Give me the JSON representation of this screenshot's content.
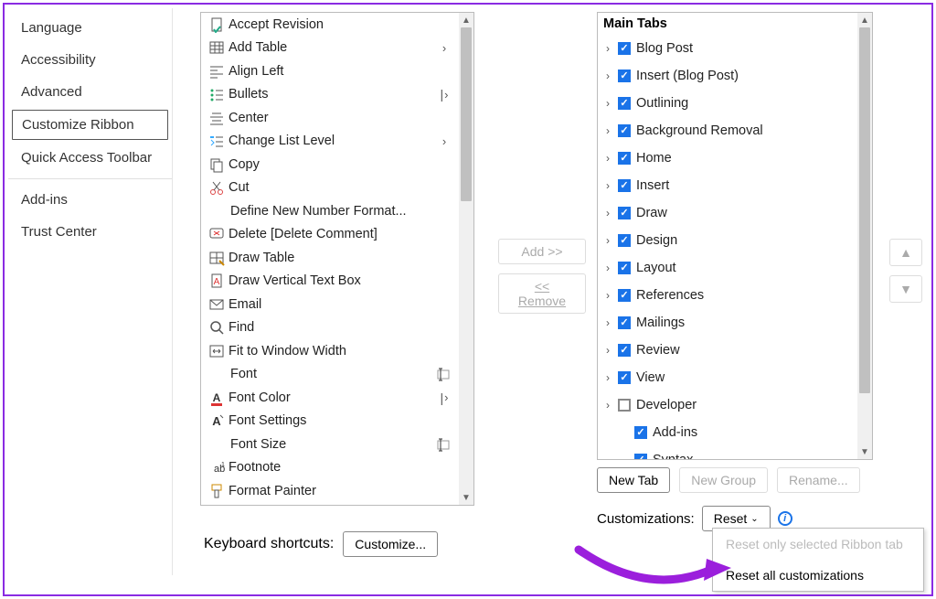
{
  "sidebar": {
    "items": [
      {
        "label": "Language",
        "sel": false
      },
      {
        "label": "Accessibility",
        "sel": false
      },
      {
        "label": "Advanced",
        "sel": false
      },
      {
        "label": "Customize Ribbon",
        "sel": true
      },
      {
        "label": "Quick Access Toolbar",
        "sel": false
      },
      {
        "divider": true
      },
      {
        "label": "Add-ins",
        "sel": false
      },
      {
        "label": "Trust Center",
        "sel": false
      }
    ]
  },
  "commands": [
    {
      "icon": "accept-revision",
      "label": "Accept Revision",
      "sub": ""
    },
    {
      "icon": "add-table",
      "label": "Add Table",
      "sub": ">"
    },
    {
      "icon": "align-left",
      "label": "Align Left",
      "sub": ""
    },
    {
      "icon": "bullets",
      "label": "Bullets",
      "sub": "|>"
    },
    {
      "icon": "center",
      "label": "Center",
      "sub": ""
    },
    {
      "icon": "change-list",
      "label": "Change List Level",
      "sub": ">"
    },
    {
      "icon": "copy",
      "label": "Copy",
      "sub": ""
    },
    {
      "icon": "cut",
      "label": "Cut",
      "sub": ""
    },
    {
      "icon": "",
      "label": "Define New Number Format...",
      "sub": ""
    },
    {
      "icon": "delete-comment",
      "label": "Delete [Delete Comment]",
      "sub": ""
    },
    {
      "icon": "draw-table",
      "label": "Draw Table",
      "sub": ""
    },
    {
      "icon": "draw-vtext",
      "label": "Draw Vertical Text Box",
      "sub": ""
    },
    {
      "icon": "email",
      "label": "Email",
      "sub": ""
    },
    {
      "icon": "find",
      "label": "Find",
      "sub": ""
    },
    {
      "icon": "fit-window",
      "label": "Fit to Window Width",
      "sub": ""
    },
    {
      "icon": "",
      "label": "Font",
      "sub": "I"
    },
    {
      "icon": "font-color",
      "label": "Font Color",
      "sub": "|>"
    },
    {
      "icon": "font-settings",
      "label": "Font Settings",
      "sub": ""
    },
    {
      "icon": "",
      "label": "Font Size",
      "sub": "I"
    },
    {
      "icon": "footnote",
      "label": "Footnote",
      "sub": ""
    },
    {
      "icon": "format-painter",
      "label": "Format Painter",
      "sub": ""
    }
  ],
  "keyboard": {
    "label": "Keyboard shortcuts:",
    "btn": "Customize..."
  },
  "mid": {
    "add": "Add >>",
    "remove": "<< Remove"
  },
  "tabs": {
    "header": "Main Tabs",
    "items": [
      {
        "label": "Blog Post",
        "checked": true,
        "exp": true
      },
      {
        "label": "Insert (Blog Post)",
        "checked": true,
        "exp": true
      },
      {
        "label": "Outlining",
        "checked": true,
        "exp": true
      },
      {
        "label": "Background Removal",
        "checked": true,
        "exp": true
      },
      {
        "label": "Home",
        "checked": true,
        "exp": true
      },
      {
        "label": "Insert",
        "checked": true,
        "exp": true
      },
      {
        "label": "Draw",
        "checked": true,
        "exp": true
      },
      {
        "label": "Design",
        "checked": true,
        "exp": true
      },
      {
        "label": "Layout",
        "checked": true,
        "exp": true
      },
      {
        "label": "References",
        "checked": true,
        "exp": true
      },
      {
        "label": "Mailings",
        "checked": true,
        "exp": true
      },
      {
        "label": "Review",
        "checked": true,
        "exp": true
      },
      {
        "label": "View",
        "checked": true,
        "exp": true
      },
      {
        "label": "Developer",
        "checked": false,
        "exp": true
      },
      {
        "label": "Add-ins",
        "checked": true,
        "exp": false,
        "child": true
      },
      {
        "label": "Syntax",
        "checked": true,
        "exp": false,
        "child": true
      }
    ]
  },
  "below": {
    "newtab": "New Tab",
    "newgroup": "New Group",
    "rename": "Rename..."
  },
  "cust": {
    "label": "Customizations:",
    "reset": "Reset"
  },
  "dropdown": {
    "item1": "Reset only selected Ribbon tab",
    "item2": "Reset all customizations"
  }
}
